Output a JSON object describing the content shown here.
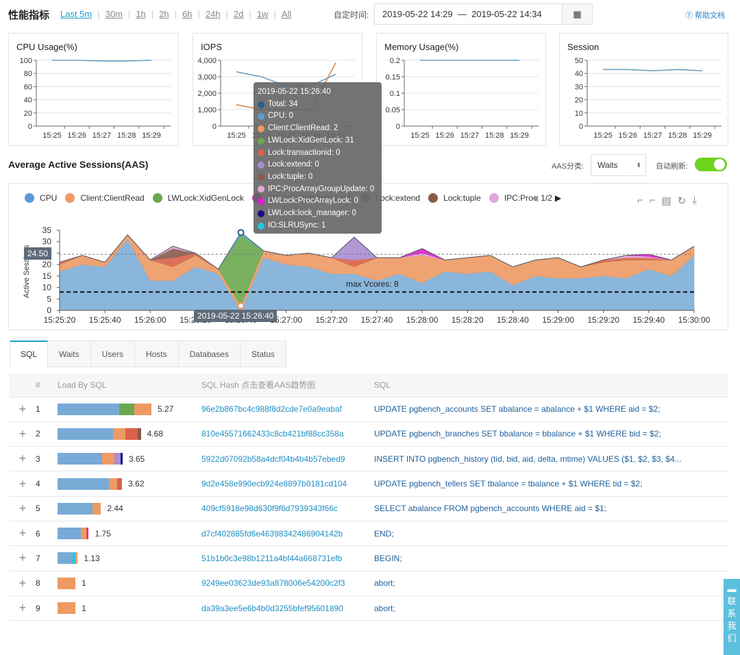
{
  "header": {
    "title": "性能指标",
    "ranges": [
      "Last 5m",
      "30m",
      "1h",
      "2h",
      "6h",
      "24h",
      "2d",
      "1w",
      "All"
    ],
    "active_range": "Last 5m",
    "custom_label": "自定时间:",
    "date_start": "2019-05-22 14:29",
    "date_sep": "—",
    "date_end": "2019-05-22 14:34",
    "help": "⑦ 帮助文档"
  },
  "colors": {
    "accent": "#1fa3c9",
    "CPU": "#78aad6",
    "Client:ClientRead": "#ee9a63",
    "LWLock:XidGenLock": "#6aa84f",
    "Lock:transactionid": "#d9634a",
    "Lock:extend": "#a98dd3",
    "Lock:tuple": "#8b5a4a",
    "IPC:ProcArrayGroupUpdate": "#e2a8d8",
    "LWLock:ProcArrayLock": "#e020d0",
    "LWLock:lock_manager": "#1a0a8c",
    "IO:SLRUSync": "#22c8e0",
    "Total": "#2a5b8f",
    "toggle": "#6ed31d"
  },
  "chart_data": [
    {
      "type": "line",
      "title": "CPU Usage(%)",
      "categories": [
        "15:25",
        "15:26",
        "15:27",
        "15:28",
        "15:29"
      ],
      "yticks": [
        "0",
        "20",
        "40",
        "60",
        "80",
        "100"
      ],
      "ylim": [
        0,
        100
      ],
      "series": [
        {
          "values": [
            100,
            100,
            99,
            99,
            100
          ],
          "color": "#6f9fbf"
        }
      ]
    },
    {
      "type": "line",
      "title": "IOPS",
      "categories": [
        "15:25",
        "15:26",
        "15:27",
        "15:28",
        "15:29"
      ],
      "yticks": [
        "0",
        "1,000",
        "2,000",
        "3,000",
        "4,000"
      ],
      "ylim": [
        0,
        4000
      ],
      "series": [
        {
          "values": [
            3300,
            3000,
            2450,
            2450,
            3150
          ],
          "color": "#6f9fbf"
        },
        {
          "values": [
            1300,
            1000,
            1000,
            1000,
            3850
          ],
          "color": "#d98a4a"
        }
      ]
    },
    {
      "type": "line",
      "title": "Memory Usage(%)",
      "categories": [
        "15:25",
        "15:26",
        "15:27",
        "15:28",
        "15:29"
      ],
      "yticks": [
        "0",
        "0.05",
        "0.1",
        "0.15",
        "0.2"
      ],
      "ylim": [
        0,
        0.2
      ],
      "series": [
        {
          "values": [
            0.2,
            0.2,
            0.2,
            0.2,
            0.2
          ],
          "color": "#6f9fbf"
        }
      ]
    },
    {
      "type": "line",
      "title": "Session",
      "categories": [
        "15:25",
        "15:26",
        "15:27",
        "15:28",
        "15:29"
      ],
      "yticks": [
        "0",
        "10",
        "20",
        "30",
        "40",
        "50"
      ],
      "ylim": [
        0,
        50
      ],
      "series": [
        {
          "values": [
            43,
            43,
            42,
            43,
            42
          ],
          "color": "#6f9fbf"
        }
      ]
    },
    {
      "type": "area",
      "title": "Average Active Sessions(AAS)",
      "ylabel": "Active Sessions",
      "ylim": [
        0,
        35
      ],
      "yticks": [
        "0",
        "5",
        "10",
        "15",
        "20",
        "25",
        "30",
        "35"
      ],
      "xticks": [
        "15:25:20",
        "15:25:40",
        "15:26:00",
        "15:26:20",
        "15:26:40",
        "15:27:00",
        "15:27:20",
        "15:27:40",
        "15:28:00",
        "15:28:20",
        "15:28:40",
        "15:29:00",
        "15:29:20",
        "15:29:40",
        "15:30:00"
      ],
      "x": [
        "15:25:20",
        "15:25:30",
        "15:25:40",
        "15:25:50",
        "15:26:00",
        "15:26:10",
        "15:26:20",
        "15:26:30",
        "15:26:40",
        "15:26:50",
        "15:27:00",
        "15:27:10",
        "15:27:20",
        "15:27:30",
        "15:27:40",
        "15:27:50",
        "15:28:00",
        "15:28:10",
        "15:28:20",
        "15:28:30",
        "15:28:40",
        "15:28:50",
        "15:29:00",
        "15:29:10",
        "15:29:20",
        "15:29:30",
        "15:29:40",
        "15:29:50",
        "15:30:00"
      ],
      "series": [
        {
          "name": "CPU",
          "values": [
            17,
            20,
            19,
            31,
            13,
            13,
            19,
            16,
            0,
            23,
            20,
            19,
            16,
            16,
            13,
            16,
            12,
            17,
            16,
            17,
            11,
            15,
            14,
            14,
            15,
            14,
            18,
            15,
            24
          ]
        },
        {
          "name": "Client:ClientRead",
          "values": [
            3,
            4,
            2,
            2,
            9,
            6,
            5,
            2,
            2,
            3,
            4,
            6,
            7,
            3,
            10,
            7,
            12,
            5,
            7,
            7,
            8,
            7,
            9,
            5,
            6,
            8,
            4,
            7,
            4
          ]
        },
        {
          "name": "LWLock:XidGenLock",
          "values": [
            0,
            0,
            0,
            0,
            0,
            0,
            0,
            0,
            31,
            0,
            0,
            0,
            0,
            0,
            0,
            0,
            0,
            0,
            0,
            0,
            0,
            0,
            0,
            0,
            0,
            0,
            0,
            0,
            0
          ]
        },
        {
          "name": "Lock:transactionid",
          "values": [
            1,
            0,
            0,
            0,
            0,
            4,
            1,
            0,
            0,
            0,
            0,
            0,
            0,
            3,
            0,
            0,
            0,
            0,
            0,
            0,
            0,
            0,
            0,
            0,
            1,
            1,
            1,
            0,
            0
          ]
        },
        {
          "name": "Lock:extend",
          "values": [
            0,
            0,
            0,
            0,
            0,
            0,
            0,
            0,
            0,
            0,
            0,
            0,
            0,
            10,
            0,
            0,
            0,
            0,
            0,
            0,
            0,
            0,
            0,
            0,
            0,
            0,
            0,
            0,
            0
          ]
        },
        {
          "name": "Lock:tuple",
          "values": [
            0,
            0,
            0,
            0,
            0,
            4,
            0,
            0,
            0,
            0,
            0,
            0,
            0,
            0,
            0,
            0,
            0,
            0,
            0,
            0,
            0,
            0,
            0,
            0,
            0,
            0,
            0,
            0,
            0
          ]
        },
        {
          "name": "IPC:ProcArrayGroupUpdate",
          "values": [
            0,
            0,
            0,
            0,
            0,
            1,
            0,
            0,
            0,
            0,
            0,
            0,
            0,
            0,
            0,
            0,
            1,
            0,
            0,
            0,
            0,
            0,
            0,
            0,
            0,
            1,
            0.5,
            0,
            0
          ]
        },
        {
          "name": "LWLock:ProcArrayLock",
          "values": [
            0,
            0,
            0,
            0,
            0,
            0,
            0,
            0,
            0,
            0,
            0,
            0,
            0,
            0,
            0,
            0,
            2,
            0,
            0,
            0,
            0,
            0,
            0,
            0,
            0,
            0,
            1,
            0,
            0
          ]
        },
        {
          "name": "IO:SLRUSync",
          "values": [
            0,
            0,
            0,
            0,
            0,
            0,
            0,
            0,
            1,
            0,
            0,
            0,
            0,
            0,
            0,
            0,
            0,
            0,
            0,
            0,
            0,
            0,
            0,
            0,
            0,
            0,
            0,
            0,
            0
          ]
        }
      ],
      "avg_line": 24.5,
      "avg_label": "24.50",
      "max_vcores": 8,
      "max_vcores_label": "max Vcores: 8",
      "crosshair_label": "2019-05-22 15:26:40"
    }
  ],
  "aas": {
    "title": "Average Active Sessions(AAS)",
    "category_label": "AAS分类:",
    "category_value": "Waits",
    "auto_refresh_label": "自动刷新:",
    "auto_refresh": true,
    "legend": [
      "CPU",
      "Client:ClientRead",
      "LWLock:XidGenLock",
      "LWLock:ProcArrayLock",
      "Lock:extend",
      "Lock:tuple",
      "IPC:Proc"
    ],
    "page": "1/2"
  },
  "tooltip": {
    "title": "2019-05-22 15:26:40",
    "rows": [
      {
        "k": "Total",
        "text": "Total: 34"
      },
      {
        "k": "CPU",
        "text": "CPU: 0"
      },
      {
        "k": "Client:ClientRead",
        "text": "Client:ClientRead: 2"
      },
      {
        "k": "LWLock:XidGenLock",
        "text": "LWLock:XidGenLock: 31"
      },
      {
        "k": "Lock:transactionid",
        "text": "Lock:transactionid: 0"
      },
      {
        "k": "Lock:extend",
        "text": "Lock:extend: 0"
      },
      {
        "k": "Lock:tuple",
        "text": "Lock:tuple: 0"
      },
      {
        "k": "IPC:ProcArrayGroupUpdate",
        "text": "IPC:ProcArrayGroupUpdate: 0"
      },
      {
        "k": "LWLock:ProcArrayLock",
        "text": "LWLock:ProcArrayLock: 0"
      },
      {
        "k": "LWLock:lock_manager",
        "text": "LWLock:lock_manager: 0"
      },
      {
        "k": "IO:SLRUSync",
        "text": "IO:SLRUSync: 1"
      }
    ]
  },
  "tabs": [
    "SQL",
    "Waits",
    "Users",
    "Hosts",
    "Databases",
    "Status"
  ],
  "table": {
    "headers": [
      "#",
      "Load By SQL",
      "SQL Hash 点击查看AAS趋势图",
      "SQL"
    ],
    "rows": [
      {
        "n": "1",
        "load": "5.27",
        "hash": "96e2b867bc4c988f8d2cde7e0a9eabaf",
        "sql": "UPDATE pgbench_accounts SET abalance = abalance + $1 WHERE aid = $2;",
        "seg": [
          [
            "CPU",
            3.45
          ],
          [
            "LWLock:XidGenLock",
            0.85
          ],
          [
            "Client:ClientRead",
            0.97
          ]
        ]
      },
      {
        "n": "2",
        "load": "4.68",
        "hash": "810e45571662433c8cb421bf88cc358a",
        "sql": "UPDATE pgbench_branches SET bbalance = bbalance + $1 WHERE bid = $2;",
        "seg": [
          [
            "CPU",
            3.1
          ],
          [
            "Client:ClientRead",
            0.7
          ],
          [
            "Lock:transactionid",
            0.7
          ],
          [
            "Lock:tuple",
            0.18
          ]
        ]
      },
      {
        "n": "3",
        "load": "3.65",
        "hash": "5922d07092b58a4dcf04b4b4b57ebed9",
        "sql": "INSERT INTO pgbench_history (tid, bid, aid, delta, mtime) VALUES ($1, $2, $3, $4...",
        "seg": [
          [
            "CPU",
            2.5
          ],
          [
            "Client:ClientRead",
            0.7
          ],
          [
            "Lock:extend",
            0.35
          ],
          [
            "LWLock:lock_manager",
            0.1
          ]
        ]
      },
      {
        "n": "4",
        "load": "3.62",
        "hash": "9d2e458e990ecb924e8897b0181cd104",
        "sql": "UPDATE pgbench_tellers SET tbalance = tbalance + $1 WHERE tid = $2;",
        "seg": [
          [
            "CPU",
            2.9
          ],
          [
            "Client:ClientRead",
            0.45
          ],
          [
            "Lock:transactionid",
            0.27
          ]
        ]
      },
      {
        "n": "5",
        "load": "2.44",
        "hash": "409cf5918e98d630f9f6d7939343f66c",
        "sql": "SELECT abalance FROM pgbench_accounts WHERE aid = $1;",
        "seg": [
          [
            "CPU",
            1.95
          ],
          [
            "Client:ClientRead",
            0.49
          ]
        ]
      },
      {
        "n": "6",
        "load": "1.75",
        "hash": "d7cf402885fd6e46398342486904142b",
        "sql": "END;",
        "seg": [
          [
            "CPU",
            1.3
          ],
          [
            "Client:ClientRead",
            0.3
          ],
          [
            "Lock:transactionid",
            0.05
          ],
          [
            "LWLock:ProcArrayLock",
            0.1
          ]
        ]
      },
      {
        "n": "7",
        "load": "1.13",
        "hash": "51b1b0c3e98b1211a4bf44a668731efb",
        "sql": "BEGIN;",
        "seg": [
          [
            "CPU",
            0.85
          ],
          [
            "IO:SLRUSync",
            0.15
          ],
          [
            "Client:ClientRead",
            0.13
          ]
        ]
      },
      {
        "n": "8",
        "load": "1",
        "hash": "9249ee03623de93a878006e54200c2f3",
        "sql": "abort;",
        "seg": [
          [
            "Client:ClientRead",
            1
          ]
        ]
      },
      {
        "n": "9",
        "load": "1",
        "hash": "da39a3ee5e6b4b0d3255bfef95601890",
        "sql": "abort;",
        "seg": [
          [
            "Client:ClientRead",
            1
          ]
        ]
      }
    ]
  },
  "contact": "联系我们"
}
